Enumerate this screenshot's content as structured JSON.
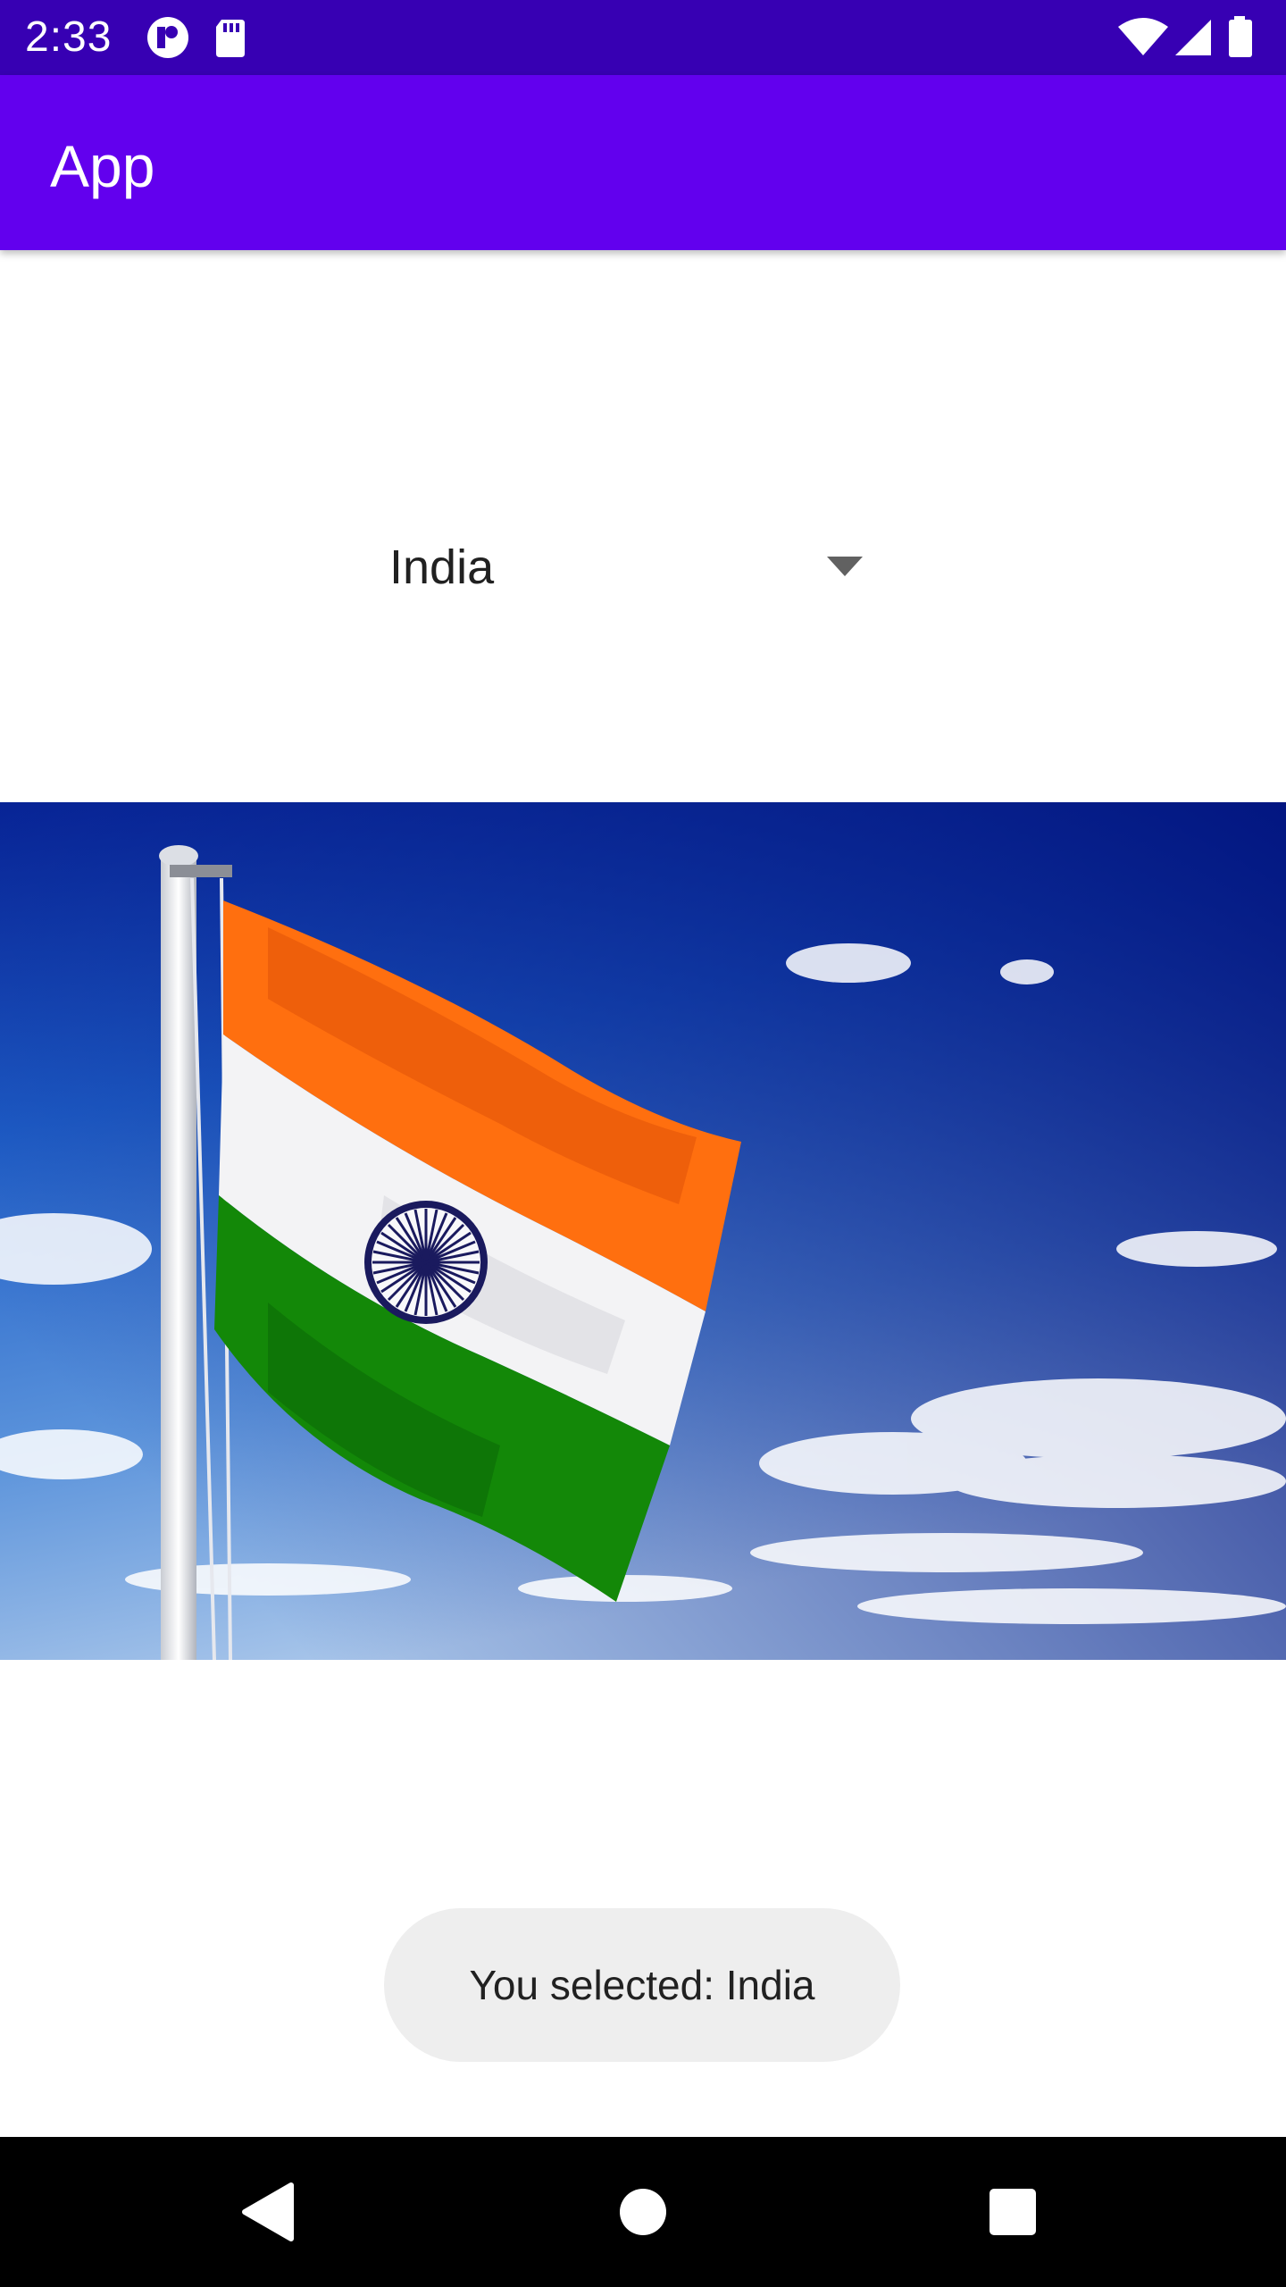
{
  "status_bar": {
    "time": "2:33",
    "left_icons": [
      "notification-icon",
      "sd-card-icon"
    ],
    "right_icons": [
      "wifi-icon",
      "signal-icon",
      "battery-icon"
    ]
  },
  "app_bar": {
    "title": "App"
  },
  "spinner": {
    "selected": "India"
  },
  "image": {
    "subject": "india-flag-photo"
  },
  "toast": {
    "message": "You selected: India"
  },
  "nav_bar": {
    "buttons": [
      "back-icon",
      "home-icon",
      "recents-icon"
    ]
  },
  "colors": {
    "status_bar": "#3700b3",
    "app_bar": "#6200ee",
    "toast_bg": "#eeeeee",
    "saffron": "#ff6f0f",
    "flag_green": "#138808",
    "chakra": "#1a1a5e",
    "sky_top": "#001a8f",
    "sky_bottom": "#8fb3e0"
  }
}
